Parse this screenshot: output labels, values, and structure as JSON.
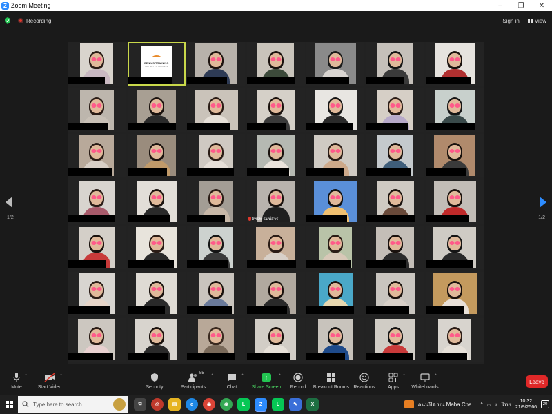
{
  "window": {
    "title": "Zoom Meeting",
    "controls": [
      "–",
      "❐",
      "✕"
    ]
  },
  "topbar": {
    "recording_label": "Recording",
    "signin_label": "Sign in",
    "view_label": "View"
  },
  "pagination": {
    "left": "1/2",
    "right": "1/2"
  },
  "gallery": {
    "logo_title": "GENIUS TRAINING",
    "logo_tagline": "THE WAY TO SUCCESS",
    "highlighted_index": 1,
    "named_tile_index": 24,
    "named_tile_text": "อิทธพ ธนพ์สาร",
    "tiles": [
      {
        "bg": "#d9d4cd",
        "shirt": "#c9b9c2",
        "hair": "#2a1c16"
      },
      {
        "bg": "#ffffff",
        "shirt": "#ffffff",
        "hair": "#ffffff"
      },
      {
        "bg": "#b8b2ab",
        "shirt": "#2e3b55",
        "hair": "#1e1410"
      },
      {
        "bg": "#c9c4bb",
        "shirt": "#3c4a3a",
        "hair": "#1a120e"
      },
      {
        "bg": "#8a8a8a",
        "shirt": "#d8d4d0",
        "hair": "#1a1a1a"
      },
      {
        "bg": "#c5c0ba",
        "shirt": "#3a3a3a",
        "hair": "#151515"
      },
      {
        "bg": "#e6e3de",
        "shirt": "#b03030",
        "hair": "#1a120e"
      },
      {
        "bg": "#bdb6ad",
        "shirt": "#c8c0b6",
        "hair": "#2a1c16"
      },
      {
        "bg": "#a89f93",
        "shirt": "#2a2a2a",
        "hair": "#1a120e"
      },
      {
        "bg": "#cac3ba",
        "shirt": "#e6e0d8",
        "hair": "#2a1c16"
      },
      {
        "bg": "#d5d0c8",
        "shirt": "#3a3a3a",
        "hair": "#1a120e"
      },
      {
        "bg": "#e8e6e2",
        "shirt": "#2a2a2a",
        "hair": "#151515"
      },
      {
        "bg": "#d6cfc6",
        "shirt": "#b7a9c9",
        "hair": "#2a1c16"
      },
      {
        "bg": "#c8d0cc",
        "shirt": "#3a4a4a",
        "hair": "#151515"
      },
      {
        "bg": "#b8a99a",
        "shirt": "#d8cfc6",
        "hair": "#2a1c16"
      },
      {
        "bg": "#9a8c7d",
        "shirt": "#c09a6a",
        "hair": "#1a120e"
      },
      {
        "bg": "#cfc9c2",
        "shirt": "#e6dfd8",
        "hair": "#2a1c16"
      },
      {
        "bg": "#b5b9b2",
        "shirt": "#eae4dc",
        "hair": "#1a120e"
      },
      {
        "bg": "#cfcac3",
        "shirt": "#cda98a",
        "hair": "#2a1c16"
      },
      {
        "bg": "#c4c9cc",
        "shirt": "#3f5e7a",
        "hair": "#1a120e"
      },
      {
        "bg": "#b08a6c",
        "shirt": "#3a3a3a",
        "hair": "#1a120e"
      },
      {
        "bg": "#d8d4cf",
        "shirt": "#a85a6a",
        "hair": "#2a1c16"
      },
      {
        "bg": "#e2ded8",
        "shirt": "#2a2a2a",
        "hair": "#1a120e"
      },
      {
        "bg": "#a39d95",
        "shirt": "#c8b8a8",
        "hair": "#2a1c16"
      },
      {
        "bg": "#b8b3ad",
        "shirt": "#1f1f1f",
        "hair": "#1a120e"
      },
      {
        "bg": "#5a8fd8",
        "shirt": "#f0c070",
        "hair": "#111111"
      },
      {
        "bg": "#cfcac3",
        "shirt": "#6a4a3a",
        "hair": "#1a120e"
      },
      {
        "bg": "#c2bdb7",
        "shirt": "#c02a2a",
        "hair": "#1a120e"
      },
      {
        "bg": "#d4cfc8",
        "shirt": "#c83a3a",
        "hair": "#1a120e"
      },
      {
        "bg": "#e8e4dc",
        "shirt": "#2a2a2a",
        "hair": "#2a1c16"
      },
      {
        "bg": "#cdd2cf",
        "shirt": "#3a3a3a",
        "hair": "#151515"
      },
      {
        "bg": "#c8b09a",
        "shirt": "#d8d0c8",
        "hair": "#2a1c16"
      },
      {
        "bg": "#b9c3a8",
        "shirt": "#d8c8b8",
        "hair": "#2a1c16"
      },
      {
        "bg": "#c4beb7",
        "shirt": "#2a2a2a",
        "hair": "#1a120e"
      },
      {
        "bg": "#cfcbc4",
        "shirt": "#2a2a2a",
        "hair": "#151515"
      },
      {
        "bg": "#d8d5d0",
        "shirt": "#e6d5c8",
        "hair": "#2a1c16"
      },
      {
        "bg": "#dfdbd4",
        "shirt": "#2a2a2a",
        "hair": "#1a120e"
      },
      {
        "bg": "#c9c4bd",
        "shirt": "#6a7a9a",
        "hair": "#1a120e"
      },
      {
        "bg": "#b1a99f",
        "shirt": "#2a2a2a",
        "hair": "#1a120e"
      },
      {
        "bg": "#4aa8c8",
        "shirt": "#e8d8b0",
        "hair": "#1a120e"
      },
      {
        "bg": "#c9c5bf",
        "shirt": "#d8d0c8",
        "hair": "#1a120e"
      },
      {
        "bg": "#c49a5e",
        "shirt": "#e8e0d8",
        "hair": "#1a120e"
      },
      {
        "bg": "#ccc7c0",
        "shirt": "#e8d0d0",
        "hair": "#2a1c16"
      },
      {
        "bg": "#d8d4ce",
        "shirt": "#2a2a2a",
        "hair": "#1a120e"
      },
      {
        "bg": "#b8a898",
        "shirt": "#7a6a5a",
        "hair": "#3a2a20"
      },
      {
        "bg": "#d2cdc6",
        "shirt": "#e6e0d8",
        "hair": "#1a120e"
      },
      {
        "bg": "#c8c3bc",
        "shirt": "#1e4a8a",
        "hair": "#151515"
      },
      {
        "bg": "#d0ccc5",
        "shirt": "#c83a3a",
        "hair": "#151515"
      },
      {
        "bg": "#d8d4ce",
        "shirt": "#e6e0d8",
        "hair": "#2a1c16"
      }
    ]
  },
  "toolbar": {
    "mute": "Mute",
    "start_video": "Start Video",
    "security": "Security",
    "participants": "Participants",
    "participants_count": "55",
    "chat": "Chat",
    "share_screen": "Share Screen",
    "record": "Record",
    "breakout_rooms": "Breakout Rooms",
    "reactions": "Reactions",
    "apps": "Apps",
    "whiteboards": "Whiteboards",
    "leave": "Leave"
  },
  "taskbar": {
    "search_placeholder": "Type here to search",
    "news_text": "ถนนปิด บน Maha Cha...",
    "language": "ไทย",
    "time": "10:32",
    "date": "21/9/2566",
    "notification_count": "20"
  },
  "colors": {
    "accent": "#2d8cff",
    "leave": "#e02828",
    "share_green": "#23c552",
    "highlight": "#c9d84a",
    "eyes": "#ff5a8a"
  }
}
